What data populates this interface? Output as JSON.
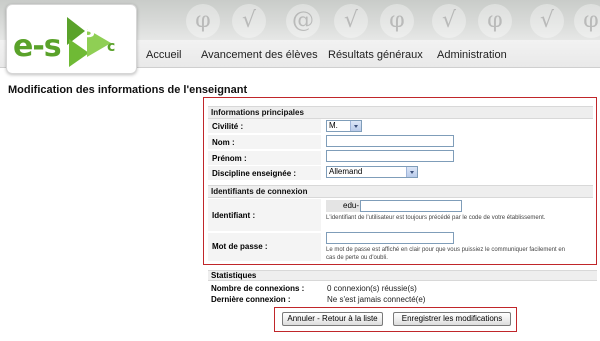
{
  "logo": {
    "text": "e-s",
    "digit": "3",
    "letter": "c"
  },
  "nav": {
    "items": [
      {
        "label": "Accueil"
      },
      {
        "label": "Avancement des élèves"
      },
      {
        "label": "Résultats généraux"
      },
      {
        "label": "Administration"
      }
    ]
  },
  "page": {
    "title": "Modification des informations de l'enseignant"
  },
  "form": {
    "main_section_title": "Informations principales",
    "civilite": {
      "label": "Civilité :",
      "value": "M."
    },
    "nom": {
      "label": "Nom :",
      "value": ""
    },
    "prenom": {
      "label": "Prénom :",
      "value": ""
    },
    "discipline": {
      "label": "Discipline enseignée :",
      "value": "Allemand"
    },
    "login_section_title": "Identifiants de connexion",
    "identifiant": {
      "label": "Identifiant :",
      "prefix": "edu-",
      "value": "",
      "hint": "L'identifiant de l'utilisateur est toujours précédé par le code de votre établissement."
    },
    "password": {
      "label": "Mot de passe :",
      "value": "",
      "hint": "Le mot de passe est affiché en clair pour que vous puissiez le communiquer facilement en cas de perte ou d'oubli."
    }
  },
  "stats": {
    "title": "Statistiques",
    "connexions_label": "Nombre de connexions :",
    "connexions_value": "0 connexion(s) réussie(s)",
    "last_label": "Dernière connexion :",
    "last_value": "Ne s'est jamais connecté(e)"
  },
  "buttons": {
    "cancel": "Annuler - Retour à la liste",
    "save": "Enregistrer les modifications"
  },
  "colors": {
    "logo_green": "#5aa22a",
    "highlight_red": "#c0262a"
  }
}
